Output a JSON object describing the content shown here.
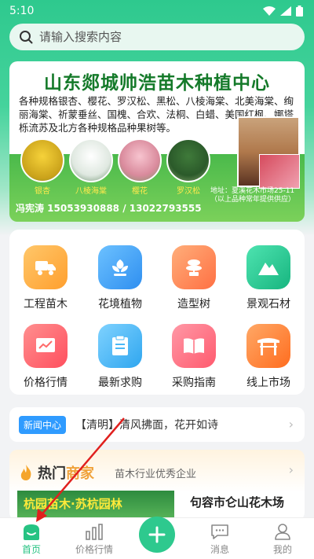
{
  "status": {
    "time": "5:10"
  },
  "search": {
    "placeholder": "请输入搜索内容"
  },
  "banner": {
    "title": "山东郯城帅浩苗木种植中心",
    "description": "各种规格银杏、樱花、罗汉松、黑松、八棱海棠、北美海棠、绚丽海棠、祈蒙垂丝、国槐、合欢、法桐、白蜡、美国红枫、娜塔栎流苏及北方各种规格品种果树等。",
    "trees": [
      "银杏",
      "八棱海棠",
      "樱花",
      "罗汉松"
    ],
    "address": "地址：夏溪花木市场25-11（以上品种常年提供供应）",
    "phone": "冯宪涛 15053930888 / 13022793555"
  },
  "categories": [
    {
      "label": "工程苗木",
      "icon": "truck-icon",
      "color": "#ffb347"
    },
    {
      "label": "花境植物",
      "icon": "flower-icon",
      "color": "#4aaaf7"
    },
    {
      "label": "造型树",
      "icon": "bonsai-icon",
      "color": "#ff8a5c"
    },
    {
      "label": "景观石材",
      "icon": "mountain-icon",
      "color": "#2fcf9a"
    },
    {
      "label": "价格行情",
      "icon": "chart-icon",
      "color": "#ff6b6b"
    },
    {
      "label": "最新求购",
      "icon": "clipboard-icon",
      "color": "#4ab8f7"
    },
    {
      "label": "采购指南",
      "icon": "book-icon",
      "color": "#ff6f7f"
    },
    {
      "label": "线上市场",
      "icon": "gate-icon",
      "color": "#ff8a3d"
    }
  ],
  "news": {
    "badge": "新闻中心",
    "text": "【清明】清风拂面，花开如诗"
  },
  "hot": {
    "title": "热门",
    "title_accent": "商家",
    "subtitle": "苗木行业优秀企业",
    "image_text": "杭园苗木·苏杭园林",
    "company": "句容市仑山花木场"
  },
  "tabs": [
    {
      "label": "首页",
      "active": true
    },
    {
      "label": "价格行情",
      "active": false
    },
    {
      "label": "",
      "active": false
    },
    {
      "label": "消息",
      "active": false
    },
    {
      "label": "我的",
      "active": false
    }
  ],
  "colors": {
    "brand": "#2ec98e",
    "active_tab": "#27c383",
    "arrow": "#e0201e"
  }
}
